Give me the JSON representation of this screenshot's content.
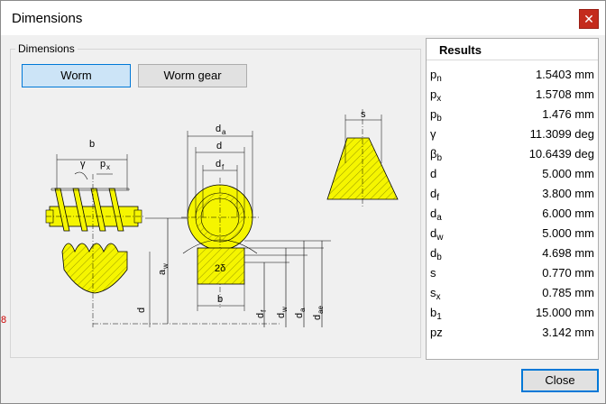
{
  "window": {
    "title": "Dimensions",
    "close_glyph": "✕"
  },
  "group": {
    "legend": "Dimensions"
  },
  "tabs": [
    {
      "label": "Worm",
      "selected": true
    },
    {
      "label": "Worm gear",
      "selected": false
    }
  ],
  "diagram_labels": {
    "b": "b",
    "gamma": "γ",
    "px": "p",
    "px_sub": "x",
    "da": "d",
    "da_sub": "a",
    "d": "d",
    "df": "d",
    "df_sub": "f",
    "s": "s",
    "two_delta": "2δ",
    "aw": "a",
    "aw_sub": "w",
    "d_bottom": "d",
    "b_bottom": "b",
    "df_b": "d",
    "df_b_sub": "f",
    "dw_b": "d",
    "dw_b_sub": "w",
    "da_b": "d",
    "da_b_sub": "a",
    "dae_b": "d",
    "dae_b_sub": "ae"
  },
  "results": {
    "title": "Results",
    "rows": [
      {
        "sym": "p",
        "sub": "n",
        "value": "1.5403 mm"
      },
      {
        "sym": "p",
        "sub": "x",
        "value": "1.5708 mm"
      },
      {
        "sym": "p",
        "sub": "b",
        "value": "1.476 mm"
      },
      {
        "sym": "γ",
        "sub": "",
        "value": "11.3099 deg"
      },
      {
        "sym": "β",
        "sub": "b",
        "value": "10.6439 deg"
      },
      {
        "sym": "d",
        "sub": "",
        "value": "5.000 mm"
      },
      {
        "sym": "d",
        "sub": "f",
        "value": "3.800 mm"
      },
      {
        "sym": "d",
        "sub": "a",
        "value": "6.000 mm"
      },
      {
        "sym": "d",
        "sub": "w",
        "value": "5.000 mm"
      },
      {
        "sym": "d",
        "sub": "b",
        "value": "4.698 mm"
      },
      {
        "sym": "s",
        "sub": "",
        "value": "0.770 mm"
      },
      {
        "sym": "s",
        "sub": "x",
        "value": "0.785 mm"
      },
      {
        "sym": "b",
        "sub": "1",
        "value": "15.000 mm"
      },
      {
        "sym": "pz",
        "sub": "",
        "value": "3.142 mm"
      }
    ]
  },
  "buttons": {
    "close": "Close"
  },
  "edge_mark": "8",
  "colors": {
    "accent": "#0078d7",
    "close_red": "#c42b1c",
    "drawing_fill": "#f5f500"
  }
}
